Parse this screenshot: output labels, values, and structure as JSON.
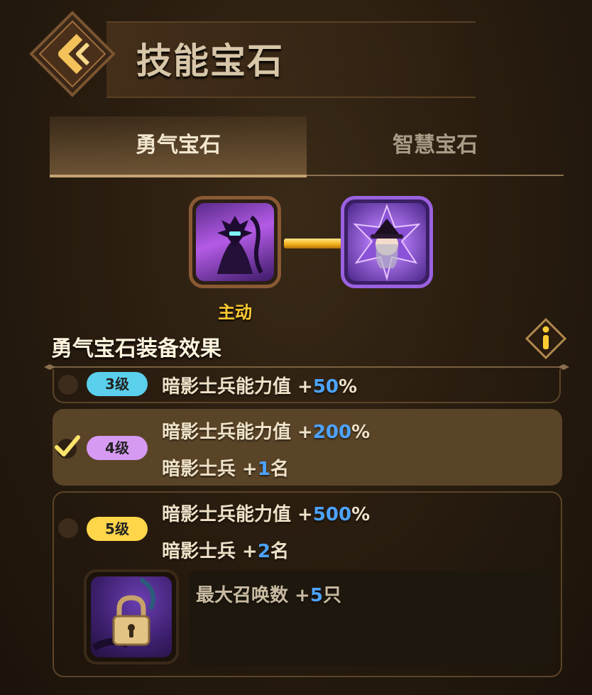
{
  "header": {
    "title": "技能宝石"
  },
  "tabs": [
    {
      "label": "勇气宝石",
      "active": true
    },
    {
      "label": "智慧宝石",
      "active": false
    }
  ],
  "skill": {
    "active_label": "主动"
  },
  "effects": {
    "title": "勇气宝石装备效果",
    "levels": [
      {
        "badge": "3级",
        "selected": false,
        "lines": [
          {
            "text": "暗影士兵能力值 +",
            "value": "50",
            "suffix": "%"
          }
        ]
      },
      {
        "badge": "4级",
        "selected": true,
        "lines": [
          {
            "text": "暗影士兵能力值 +",
            "value": "200",
            "suffix": "%"
          },
          {
            "text": "暗影士兵 +",
            "value": "1",
            "suffix": "名"
          }
        ]
      },
      {
        "badge": "5级",
        "selected": false,
        "lines": [
          {
            "text": "暗影士兵能力值 +",
            "value": "500",
            "suffix": "%"
          },
          {
            "text": "暗影士兵 +",
            "value": "2",
            "suffix": "名"
          }
        ],
        "unlock": {
          "text": "最大召唤数 +",
          "value": "5",
          "suffix": "只"
        }
      }
    ]
  },
  "colors": {
    "accent_gold": "#ffcc33",
    "value_blue": "#4da3ff",
    "badge_lv3": "#5bd0ec",
    "badge_lv4": "#d79af2",
    "badge_lv5": "#ffd54a"
  },
  "icons": {
    "back": "back-chevron-icon",
    "info": "info-icon",
    "check": "checkmark-icon",
    "lock": "lock-icon"
  }
}
